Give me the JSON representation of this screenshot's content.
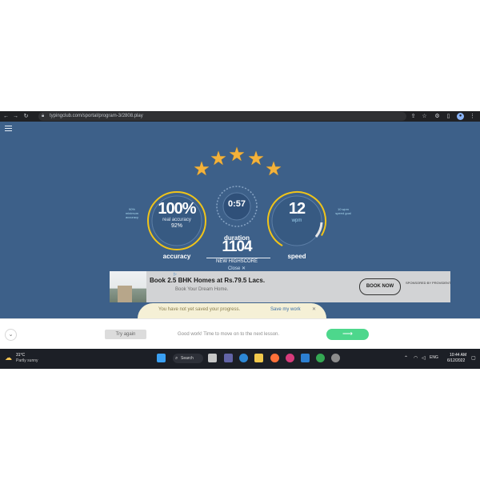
{
  "browser": {
    "url": "typingclub.com/sportal/program-3/2808.play",
    "colors": {
      "frame": "#202124",
      "omnibox": "#303134"
    }
  },
  "page": {
    "colors": {
      "background": "#3d6089",
      "ring": "#f0c419",
      "accent": "#4dd78c"
    },
    "stars": {
      "count": 5,
      "icon": "star-icon"
    },
    "accuracy": {
      "value": "100%",
      "sub1": "real accuracy",
      "sub2": "92%",
      "caption": "accuracy",
      "left_tick": "90%",
      "left_tick_sub": "minimum accuracy"
    },
    "duration": {
      "value": "0:57",
      "sub": "",
      "caption": "duration"
    },
    "speed": {
      "value": "12",
      "unit": "wpm",
      "caption": "speed",
      "right_tick": "10 wpm",
      "right_tick_sub": "speed goal"
    },
    "score": {
      "value": "1104",
      "label": "NEW HIGHSCORE",
      "close": "Close ✕"
    },
    "ad": {
      "badge": "▷",
      "title": "Book 2.5 BHK Homes at Rs.79.5 Lacs.",
      "subtitle": "Book Your Dream Home.",
      "button": "BOOK NOW",
      "sponsored": "SPONSORED BY PROVIDENT"
    },
    "save_banner": {
      "text": "You have not yet saved your progress.",
      "link": "Save my work",
      "close": "✕"
    }
  },
  "footer": {
    "collapse_icon": "⌄",
    "try_again": "Try again",
    "message": "Good work! Time to move on to the next lesson.",
    "next_icon": "⟶"
  },
  "taskbar": {
    "weather_temp": "31°C",
    "weather_desc": "Partly sunny",
    "search": "Search",
    "lang": "ENG",
    "time": "10:44 AM",
    "date": "6/12/2022"
  }
}
